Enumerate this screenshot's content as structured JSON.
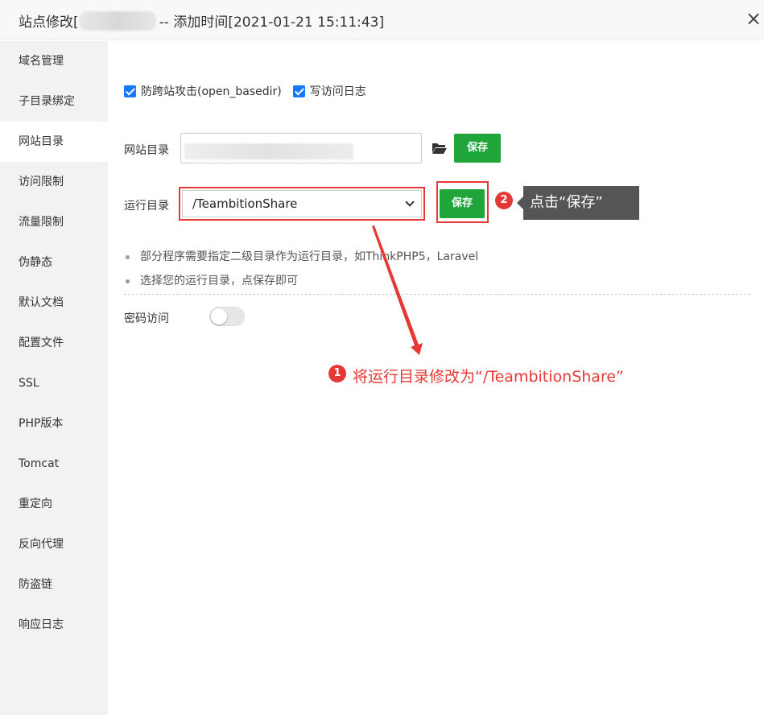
{
  "header": {
    "title_prefix": "站点修改[",
    "title_suffix": "-- 添加时间[2021-01-21 15:11:43]",
    "close_label": "×"
  },
  "sidebar": {
    "items": [
      {
        "label": "域名管理"
      },
      {
        "label": "子目录绑定"
      },
      {
        "label": "网站目录",
        "active": true
      },
      {
        "label": "访问限制"
      },
      {
        "label": "流量限制"
      },
      {
        "label": "伪静态"
      },
      {
        "label": "默认文档"
      },
      {
        "label": "配置文件"
      },
      {
        "label": "SSL"
      },
      {
        "label": "PHP版本"
      },
      {
        "label": "Tomcat"
      },
      {
        "label": "重定向"
      },
      {
        "label": "反向代理"
      },
      {
        "label": "防盗链"
      },
      {
        "label": "响应日志"
      }
    ]
  },
  "main": {
    "checkbox_open_basedir": {
      "label": "防跨站攻击(open_basedir)",
      "checked": true
    },
    "checkbox_access_log": {
      "label": "写访问日志",
      "checked": true
    },
    "site_dir_label": "网站目录",
    "site_dir_save": "保存",
    "run_dir_label": "运行目录",
    "run_dir_value": "/TeambitionShare",
    "run_dir_save": "保存",
    "tips": [
      "部分程序需要指定二级目录作为运行目录，如ThinkPHP5，Laravel",
      "选择您的运行目录，点保存即可"
    ],
    "password_access_label": "密码访问",
    "password_access_enabled": false
  },
  "annotations": {
    "step1_number": "1",
    "step1_text": "将运行目录修改为“/TeambitionShare”",
    "step2_number": "2",
    "step2_text": "点击“保存”",
    "accent_color": "#e53935"
  },
  "colors": {
    "save_button": "#20a53a",
    "checkbox": "#1677ff"
  }
}
